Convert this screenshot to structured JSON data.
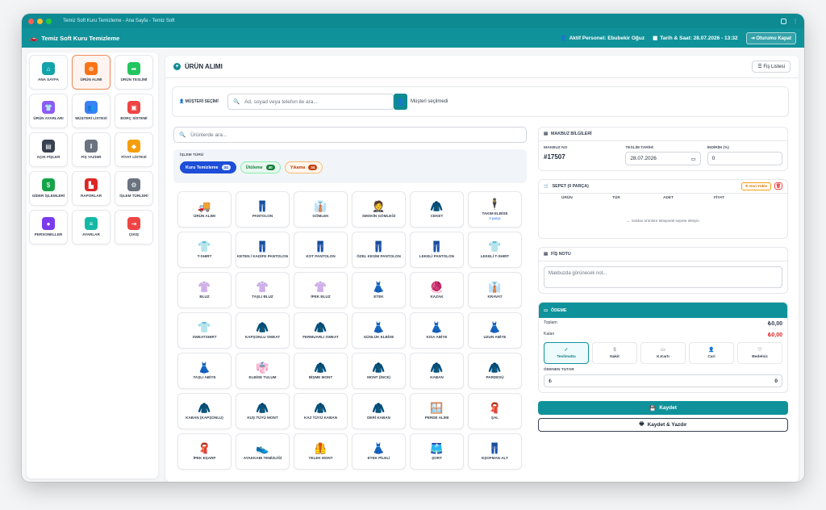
{
  "window": {
    "title": "Temiz Soft Kuru Temizleme - Ana Sayfa - Temiz Soft"
  },
  "appbar": {
    "brand": "Temiz Soft Kuru Temizleme",
    "personnel": "Aktif Personel: Ebubekir Oğuz",
    "datetime": "Tarih & Saat: 28.07.2026 - 13:32",
    "logout": "Oturumu Kapat"
  },
  "sidebar": {
    "items": [
      {
        "label": "ANA SAYFA",
        "icon": "home-icon",
        "color": "#14a3a8",
        "glyph": "⌂"
      },
      {
        "label": "ÜRÜN ALIMI",
        "icon": "plus-circle-icon",
        "color": "#f97316",
        "glyph": "⊕"
      },
      {
        "label": "ÜRÜN TESLİMİ",
        "icon": "handover-icon",
        "color": "#22c55e",
        "glyph": "➦"
      },
      {
        "label": "ÜRÜN AYARLARI",
        "icon": "tshirt-icon",
        "color": "#8b5cf6",
        "glyph": "👕"
      },
      {
        "label": "MÜŞTERİ LİSTESİ",
        "icon": "users-icon",
        "color": "#3b82f6",
        "glyph": "👥"
      },
      {
        "label": "BORÇ SİSTEMİ",
        "icon": "wallet-icon",
        "color": "#ef4444",
        "glyph": "▣"
      },
      {
        "label": "AÇIK FİŞLER",
        "icon": "file-icon",
        "color": "#374151",
        "glyph": "▤"
      },
      {
        "label": "FİŞ YAZDIR",
        "icon": "barcode-icon",
        "color": "#6b7280",
        "glyph": "‖"
      },
      {
        "label": "FİYAT LİSTESİ",
        "icon": "tag-icon",
        "color": "#f59e0b",
        "glyph": "◆"
      },
      {
        "label": "GİDER İŞLEMLERİ",
        "icon": "cash-icon",
        "color": "#16a34a",
        "glyph": "$"
      },
      {
        "label": "RAPORLAR",
        "icon": "chart-icon",
        "color": "#dc2626",
        "glyph": "▙"
      },
      {
        "label": "İŞLEM TÜRLERİ",
        "icon": "gears-icon",
        "color": "#6b7280",
        "glyph": "⚙"
      },
      {
        "label": "PERSONELLER",
        "icon": "user-icon",
        "color": "#7c3aed",
        "glyph": "●"
      },
      {
        "label": "AYARLAR",
        "icon": "sliders-icon",
        "color": "#14b8a6",
        "glyph": "≡"
      },
      {
        "label": "ÇIKIŞ",
        "icon": "logout-icon",
        "color": "#ef4444",
        "glyph": "⇥"
      }
    ]
  },
  "main": {
    "title": "ÜRÜN ALIMI",
    "receipt_list": "Fiş Listesi",
    "customer": {
      "label": "MÜŞTERİ SEÇİMİ",
      "placeholder": "Ad, soyad veya telefon ile ara...",
      "status": "Müşteri seçilmedi"
    },
    "product_search": {
      "placeholder": "Ürünlerde ara..."
    },
    "process_type": {
      "label": "İŞLEM TÜRÜ",
      "chips": [
        {
          "label": "Kuru Temizleme",
          "count": "34"
        },
        {
          "label": "Ütüleme",
          "count": "40"
        },
        {
          "label": "Yıkama",
          "count": "34"
        }
      ]
    },
    "products": [
      {
        "label": "ÜRÜN ALIMI",
        "glyph": "🚚",
        "sub": ""
      },
      {
        "label": "PANTOLON",
        "glyph": "👖",
        "sub": ""
      },
      {
        "label": "GÖMLEK",
        "glyph": "👔",
        "sub": ""
      },
      {
        "label": "SMOKİN GÖMLEĞİ",
        "glyph": "🤵",
        "sub": ""
      },
      {
        "label": "CEKET",
        "glyph": "🧥",
        "sub": ""
      },
      {
        "label": "TAKIM ELBİSE",
        "glyph": "🕴",
        "sub": "2 parça"
      },
      {
        "label": "T-SHIRT",
        "glyph": "👕",
        "sub": ""
      },
      {
        "label": "KETEN / KADİFE PANTOLON",
        "glyph": "👖",
        "sub": ""
      },
      {
        "label": "KOT PANTOLON",
        "glyph": "👖",
        "sub": ""
      },
      {
        "label": "ÖZEL KESİM PANTOLON",
        "glyph": "👖",
        "sub": ""
      },
      {
        "label": "LEKELİ PANTOLON",
        "glyph": "👖",
        "sub": ""
      },
      {
        "label": "LEKELİ T-SHIRT",
        "glyph": "👕",
        "sub": ""
      },
      {
        "label": "BLUZ",
        "glyph": "👚",
        "sub": ""
      },
      {
        "label": "TAŞLI BLUZ",
        "glyph": "👚",
        "sub": ""
      },
      {
        "label": "İPEK BLUZ",
        "glyph": "👚",
        "sub": ""
      },
      {
        "label": "ETEK",
        "glyph": "👗",
        "sub": ""
      },
      {
        "label": "KAZAK",
        "glyph": "🧶",
        "sub": ""
      },
      {
        "label": "KRAVAT",
        "glyph": "👔",
        "sub": ""
      },
      {
        "label": "SWEATSHIRT",
        "glyph": "👕",
        "sub": ""
      },
      {
        "label": "KAPŞONLU SWEAT",
        "glyph": "🧥",
        "sub": ""
      },
      {
        "label": "FERMUARLI SWEAT",
        "glyph": "🧥",
        "sub": ""
      },
      {
        "label": "GÜNLÜK ELBİSE",
        "glyph": "👗",
        "sub": ""
      },
      {
        "label": "KISA ABİYE",
        "glyph": "👗",
        "sub": ""
      },
      {
        "label": "UZUN ABİYE",
        "glyph": "👗",
        "sub": ""
      },
      {
        "label": "TAŞLI ABİYE",
        "glyph": "👗",
        "sub": ""
      },
      {
        "label": "ELBİSE TULUM",
        "glyph": "👘",
        "sub": ""
      },
      {
        "label": "BİŞME MONT",
        "glyph": "🧥",
        "sub": ""
      },
      {
        "label": "MONT (İNCE)",
        "glyph": "🧥",
        "sub": ""
      },
      {
        "label": "KABAN",
        "glyph": "🧥",
        "sub": ""
      },
      {
        "label": "PARDESÜ",
        "glyph": "🧥",
        "sub": ""
      },
      {
        "label": "KABAN (KAPŞONLU)",
        "glyph": "🧥",
        "sub": ""
      },
      {
        "label": "KUŞ TÜYÜ MONT",
        "glyph": "🧥",
        "sub": ""
      },
      {
        "label": "KAZ TÜYÜ KABAN",
        "glyph": "🧥",
        "sub": ""
      },
      {
        "label": "DERİ KABAN",
        "glyph": "🧥",
        "sub": ""
      },
      {
        "label": "PERDE ALIMI",
        "glyph": "🪟",
        "sub": ""
      },
      {
        "label": "ŞAL",
        "glyph": "🧣",
        "sub": ""
      },
      {
        "label": "İPEK EŞARP",
        "glyph": "🧣",
        "sub": ""
      },
      {
        "label": "AYAKKABI TEMİZLİĞİ",
        "glyph": "👟",
        "sub": ""
      },
      {
        "label": "YELEK MONT",
        "glyph": "🦺",
        "sub": ""
      },
      {
        "label": "ETEK PİLELİ",
        "glyph": "👗",
        "sub": ""
      },
      {
        "label": "ŞORT",
        "glyph": "🩳",
        "sub": ""
      },
      {
        "label": "EŞOFMAN ALT",
        "glyph": "👖",
        "sub": ""
      },
      {
        "label": "",
        "glyph": "👗",
        "sub": ""
      },
      {
        "label": "",
        "glyph": "🧥",
        "sub": ""
      },
      {
        "label": "",
        "glyph": "🧥",
        "sub": ""
      },
      {
        "label": "",
        "glyph": "👖",
        "sub": ""
      },
      {
        "label": "",
        "glyph": "👖",
        "sub": ""
      },
      {
        "label": "",
        "glyph": "🧥",
        "sub": ""
      }
    ],
    "receipt": {
      "title": "MAKBUZ BİLGİLERİ",
      "no_label": "MAKBUZ NO",
      "no_value": "#17507",
      "date_label": "TESLİM TARİHİ",
      "date_value": "28.07.2026",
      "discount_label": "İNDİRİM (%)",
      "discount_value": "0"
    },
    "cart": {
      "title": "SEPET (0 PARÇA)",
      "clear": "Geri Yükle",
      "cols": [
        "ÜRÜN",
        "TÜR",
        "ADET",
        "FİYAT"
      ],
      "empty": "← Soldan ürünlere tıklayarak sepete ekleyin"
    },
    "note": {
      "title": "FİŞ NOTU",
      "placeholder": "Makbuzda görünecek not..."
    },
    "payment": {
      "title": "ÖDEME",
      "total_label": "Toplam",
      "total_value": "₺0,00",
      "remaining_label": "Kalan",
      "remaining_value": "₺0,00",
      "remaining_color": "#dc2626",
      "methods": [
        {
          "label": "Teslimatta"
        },
        {
          "label": "Nakit"
        },
        {
          "label": "K.Kartı"
        },
        {
          "label": "Cari"
        },
        {
          "label": "Bedelsiz"
        }
      ],
      "paid_label": "ÖDENEN TUTAR",
      "paid_currency": "₺",
      "paid_value": "0"
    },
    "save": "Kaydet",
    "save_print": "Kaydet & Yazdır"
  }
}
